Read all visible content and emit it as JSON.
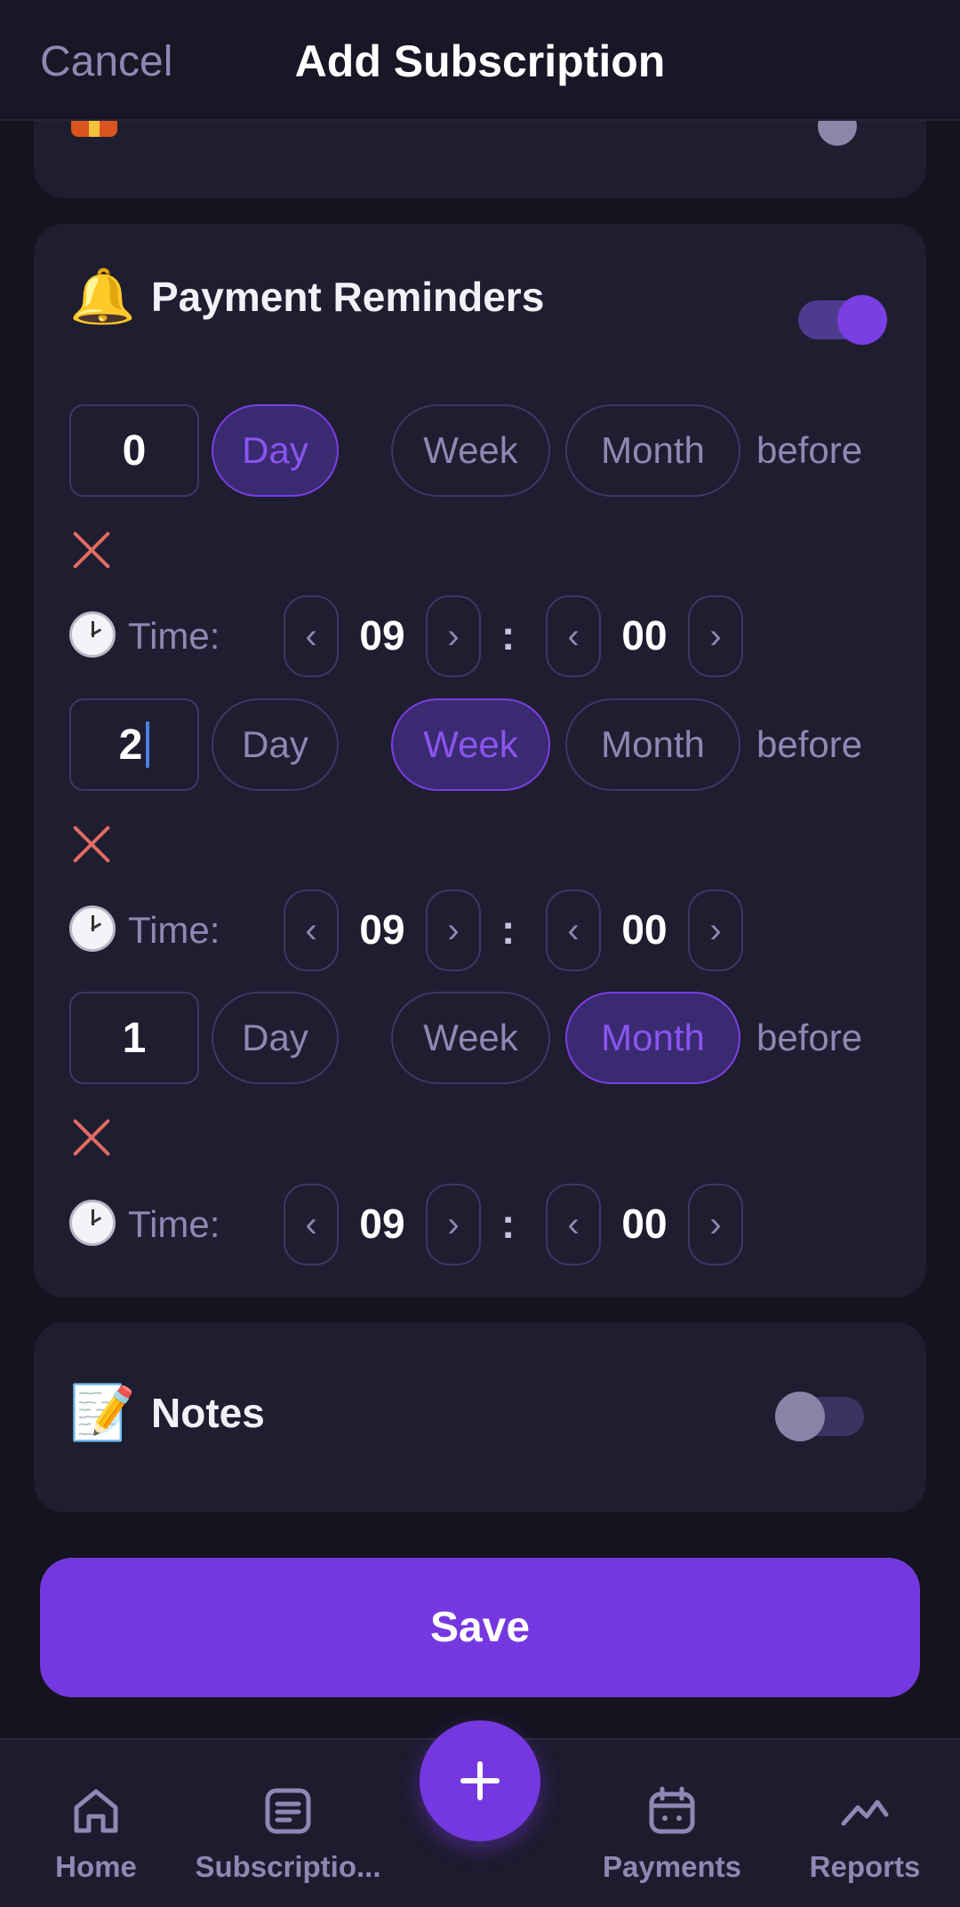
{
  "header": {
    "cancel_label": "Cancel",
    "title": "Add Subscription"
  },
  "top_card": {
    "icon": "gift-icon"
  },
  "reminders": {
    "icon": "bell-icon",
    "emoji": "🔔",
    "title": "Payment Reminders",
    "enabled": true,
    "time_label": "Time:",
    "before_label": "before",
    "units": [
      "Day",
      "Week",
      "Month"
    ],
    "items": [
      {
        "value": "0",
        "unit": "Day",
        "hour": "09",
        "minute": "00"
      },
      {
        "value": "2",
        "unit": "Week",
        "hour": "09",
        "minute": "00"
      },
      {
        "value": "1",
        "unit": "Month",
        "hour": "09",
        "minute": "00"
      }
    ],
    "stepper_prev": "‹",
    "stepper_next": "›",
    "colon": ":"
  },
  "notes": {
    "icon": "memo-icon",
    "emoji": "📝",
    "title": "Notes",
    "enabled": false
  },
  "save_label": "Save",
  "nav": {
    "home": "Home",
    "subscriptions": "Subscriptio...",
    "payments": "Payments",
    "reports": "Reports"
  },
  "colors": {
    "accent": "#7538e0",
    "background": "#14131f",
    "card": "#1f1d30",
    "danger": "#e26b62"
  }
}
